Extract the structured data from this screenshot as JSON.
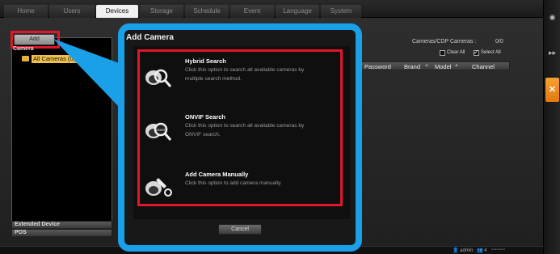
{
  "nav": {
    "tabs": [
      {
        "label": "Home"
      },
      {
        "label": "Users"
      },
      {
        "label": "Devices"
      },
      {
        "label": "Storage"
      },
      {
        "label": "Schedule"
      },
      {
        "label": "Event"
      },
      {
        "label": "Language"
      },
      {
        "label": "System"
      }
    ],
    "active_tab": "Devices"
  },
  "left_panel": {
    "add_label": "Add",
    "camera_label": "Camera",
    "tree_root": "All Cameras (0)",
    "extended_device": "Extended Device",
    "pos": "POS"
  },
  "camera_list": {
    "count_label": "Cameras/CDP Cameras :",
    "count_value": "0/0",
    "clear_all": "Clear All",
    "select_all": "Select All",
    "columns": [
      "Password",
      "Brand",
      "Model",
      "Channel"
    ]
  },
  "dialog": {
    "title": "Add Camera",
    "options": [
      {
        "title": "Hybrid Search",
        "desc": "Click this option to search all available cameras by multiple search method.",
        "icon": "hybrid-search-icon"
      },
      {
        "title": "ONVIF Search",
        "desc": "Click this option to search all available cameras by ONVIF search.",
        "icon": "onvif-search-icon"
      },
      {
        "title": "Add Camera Manually",
        "desc": "Click this option to add camera manually.",
        "icon": "add-camera-manually-icon"
      }
    ],
    "cancel_label": "Cancel"
  },
  "status": {
    "user": "admin",
    "count": "4"
  },
  "colors": {
    "highlight_red": "#e0162b",
    "callout_blue": "#1aa0e8",
    "accent_orange": "#f29020"
  }
}
